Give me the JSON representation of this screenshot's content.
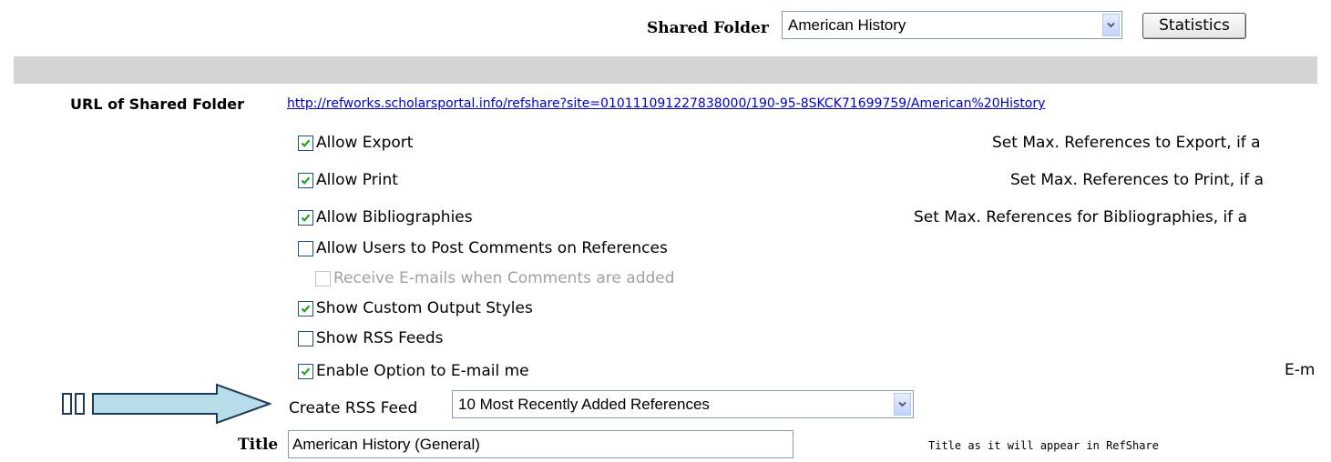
{
  "header": {
    "shared_folder_label": "Shared Folder",
    "shared_folder_value": "American History",
    "statistics_button": "Statistics"
  },
  "url_row": {
    "label": "URL of Shared Folder",
    "link": "http://refworks.scholarsportal.info/refshare?site=010111091227838000/190-95-8SKCK71699759/American%20History"
  },
  "options": [
    {
      "label": "Allow Export",
      "checked": true,
      "disabled": false
    },
    {
      "label": "Allow Print",
      "checked": true,
      "disabled": false
    },
    {
      "label": "Allow Bibliographies",
      "checked": true,
      "disabled": false
    },
    {
      "label": "Allow Users to Post Comments on References",
      "checked": false,
      "disabled": false
    },
    {
      "label": "Receive E-mails when Comments are added",
      "checked": false,
      "disabled": true
    },
    {
      "label": "Show Custom Output Styles",
      "checked": true,
      "disabled": false
    },
    {
      "label": "Show RSS Feeds",
      "checked": false,
      "disabled": false
    },
    {
      "label": "Enable Option to E-mail me",
      "checked": true,
      "disabled": false
    }
  ],
  "right_column": {
    "export_max": "Set Max. References to Export, if a",
    "print_max": "Set Max. References to Print, if a",
    "bib_max": "Set Max. References for Bibliographies, if a",
    "email_cut": "E-m"
  },
  "rss": {
    "label": "Create RSS Feed",
    "value": "10 Most Recently Added References"
  },
  "title_row": {
    "label": "Title",
    "value": "American History (General)",
    "note": "Title as it will appear in RefShare"
  },
  "colors": {
    "link": "#0000cc",
    "arrow_fill": "#b7dde8",
    "bar": "#d4d4d4",
    "checkmark": "#21a121"
  }
}
